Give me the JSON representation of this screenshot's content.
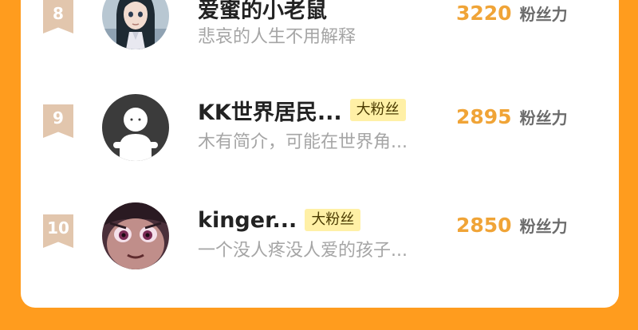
{
  "ranking": {
    "rows": [
      {
        "rank": "8",
        "name": "爱蜜的小老鼠",
        "badge": "",
        "bio": "悲哀的人生不用解释",
        "count": "3220",
        "count_label": "粉丝力",
        "avatar_icon": "anime-girl-avatar-icon"
      },
      {
        "rank": "9",
        "name": "KK世界居民...",
        "badge": "大粉丝",
        "bio": "木有简介，可能在世界角...",
        "count": "2895",
        "count_label": "粉丝力",
        "avatar_icon": "default-user-avatar-icon"
      },
      {
        "rank": "10",
        "name": "kinger...",
        "badge": "大粉丝",
        "bio": "一个没人疼没人爱的孩子...",
        "count": "2850",
        "count_label": "粉丝力",
        "avatar_icon": "anime-boy-avatar-icon"
      }
    ]
  },
  "colors": {
    "background": "#ff9c1e",
    "card": "#ffffff",
    "rank_ribbon": "#e2c6ad",
    "count": "#f0a437",
    "badge_bg": "#fff0a6",
    "bio": "#a5a5a5"
  }
}
